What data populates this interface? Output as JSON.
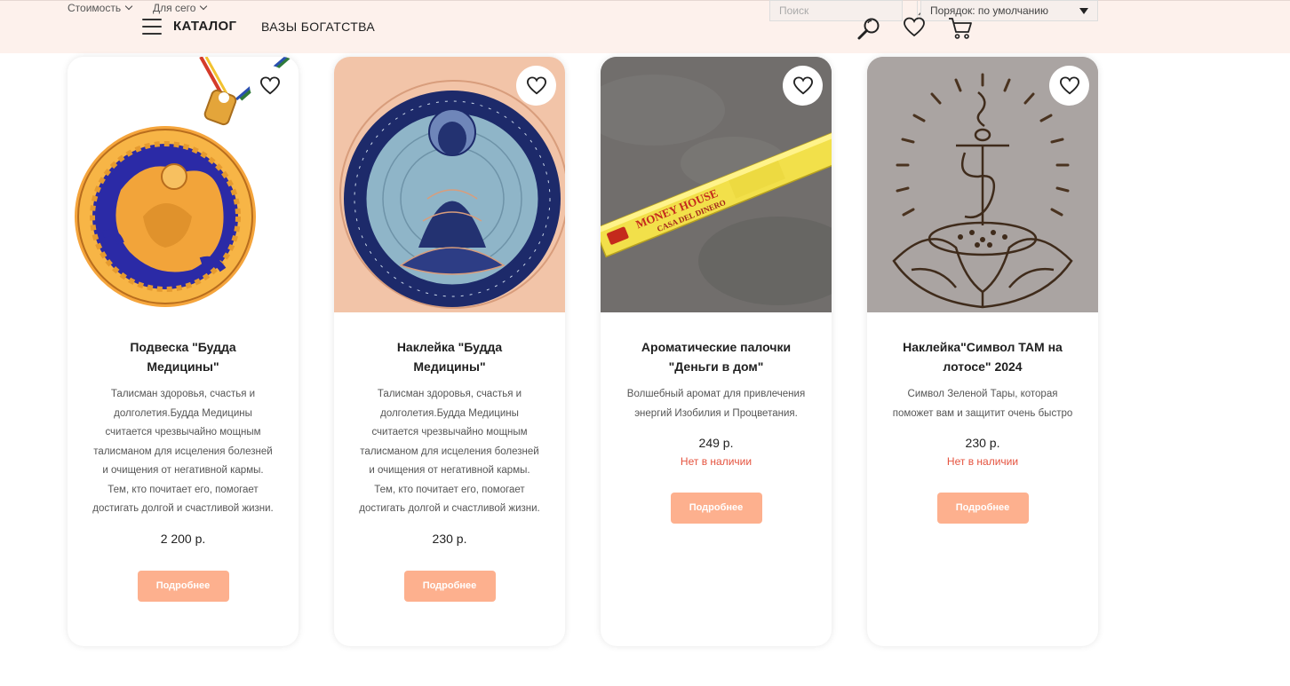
{
  "header": {
    "filter_price": "Стоимость",
    "filter_for_whom": "Для сего",
    "catalog_label": "КАТАЛОГ",
    "category_label": "ВАЗЫ БОГАТСТВА",
    "search_placeholder": "Поиск",
    "sort_label": "Порядок: по умолчанию"
  },
  "products": [
    {
      "title": "Подвеска \"Будда Медицины\"",
      "description": "Талисман здоровья, счастья и долголетия.Будда Медицины считается чрезвычайно мощным талисманом для исцеления болезней и очищения от негативной кармы. Тем, кто почитает его, помогает достигать долгой и счастливой жизни.",
      "price": "2 200 р.",
      "stock": "",
      "button": "Подробнее"
    },
    {
      "title": "Наклейка \"Будда Медицины\"",
      "description": "Талисман здоровья, счастья и долголетия.Будда Медицины считается чрезвычайно мощным талисманом для исцеления болезней и очищения от негативной кармы. Тем, кто почитает его, помогает достигать долгой и счастливой жизни.",
      "price": "230 р.",
      "stock": "",
      "button": "Подробнее"
    },
    {
      "title": "Ароматические палочки \"Деньги в дом\"",
      "description": "Волшебный аромат для привлечения энергий Изобилия и Процветания.",
      "price": "249 р.",
      "stock": "Нет в наличии",
      "button": "Подробнее",
      "package_text_1": "MONEY HOUSE",
      "package_text_2": "CASA DEL DINERO"
    },
    {
      "title": "Наклейка\"Символ ТАМ на лотосе\" 2024",
      "description": "Символ Зеленой Тары, которая поможет вам и защитит очень быстро",
      "price": "230 р.",
      "stock": "Нет в наличии",
      "button": "Подробнее"
    }
  ],
  "colors": {
    "header_bg": "#fdf1ec",
    "button_bg": "#fdb08e",
    "out_of_stock": "#e5533f"
  }
}
